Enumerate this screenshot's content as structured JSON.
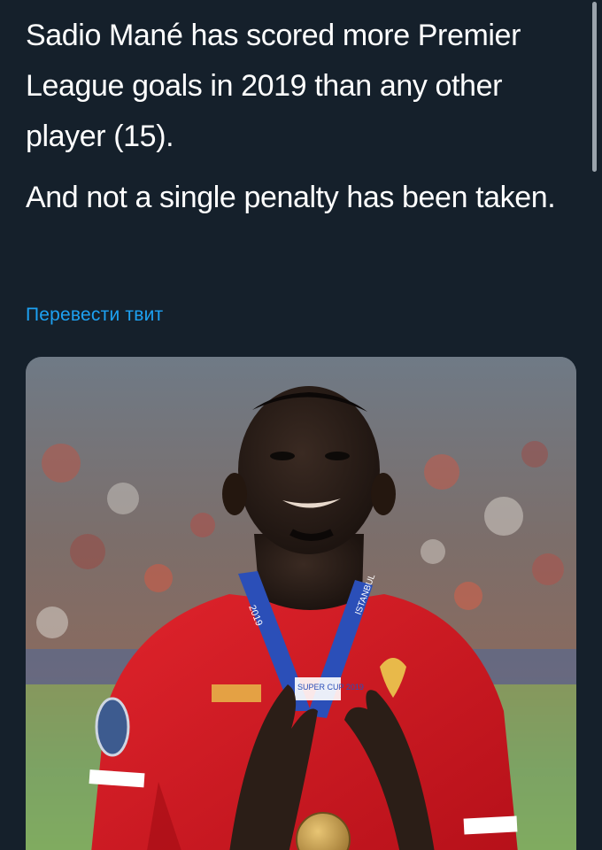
{
  "tweet": {
    "paragraph_1": "Sadio Mané has scored more Premier League goals in 2019 than any other player (15).",
    "paragraph_2": "And not a single penalty has been taken."
  },
  "translate": {
    "label": "Перевести твит"
  },
  "media": {
    "medal_ribbon_text_left": "2019",
    "medal_ribbon_text_right": "ISTANBUL",
    "medal_ribbon_text_center": "SUPER CUP 2019",
    "colors": {
      "background": "#15202b",
      "link": "#1da1f2",
      "text": "#ffffff",
      "jersey": "#d0141c",
      "ribbon": "#2b4fb8"
    }
  }
}
